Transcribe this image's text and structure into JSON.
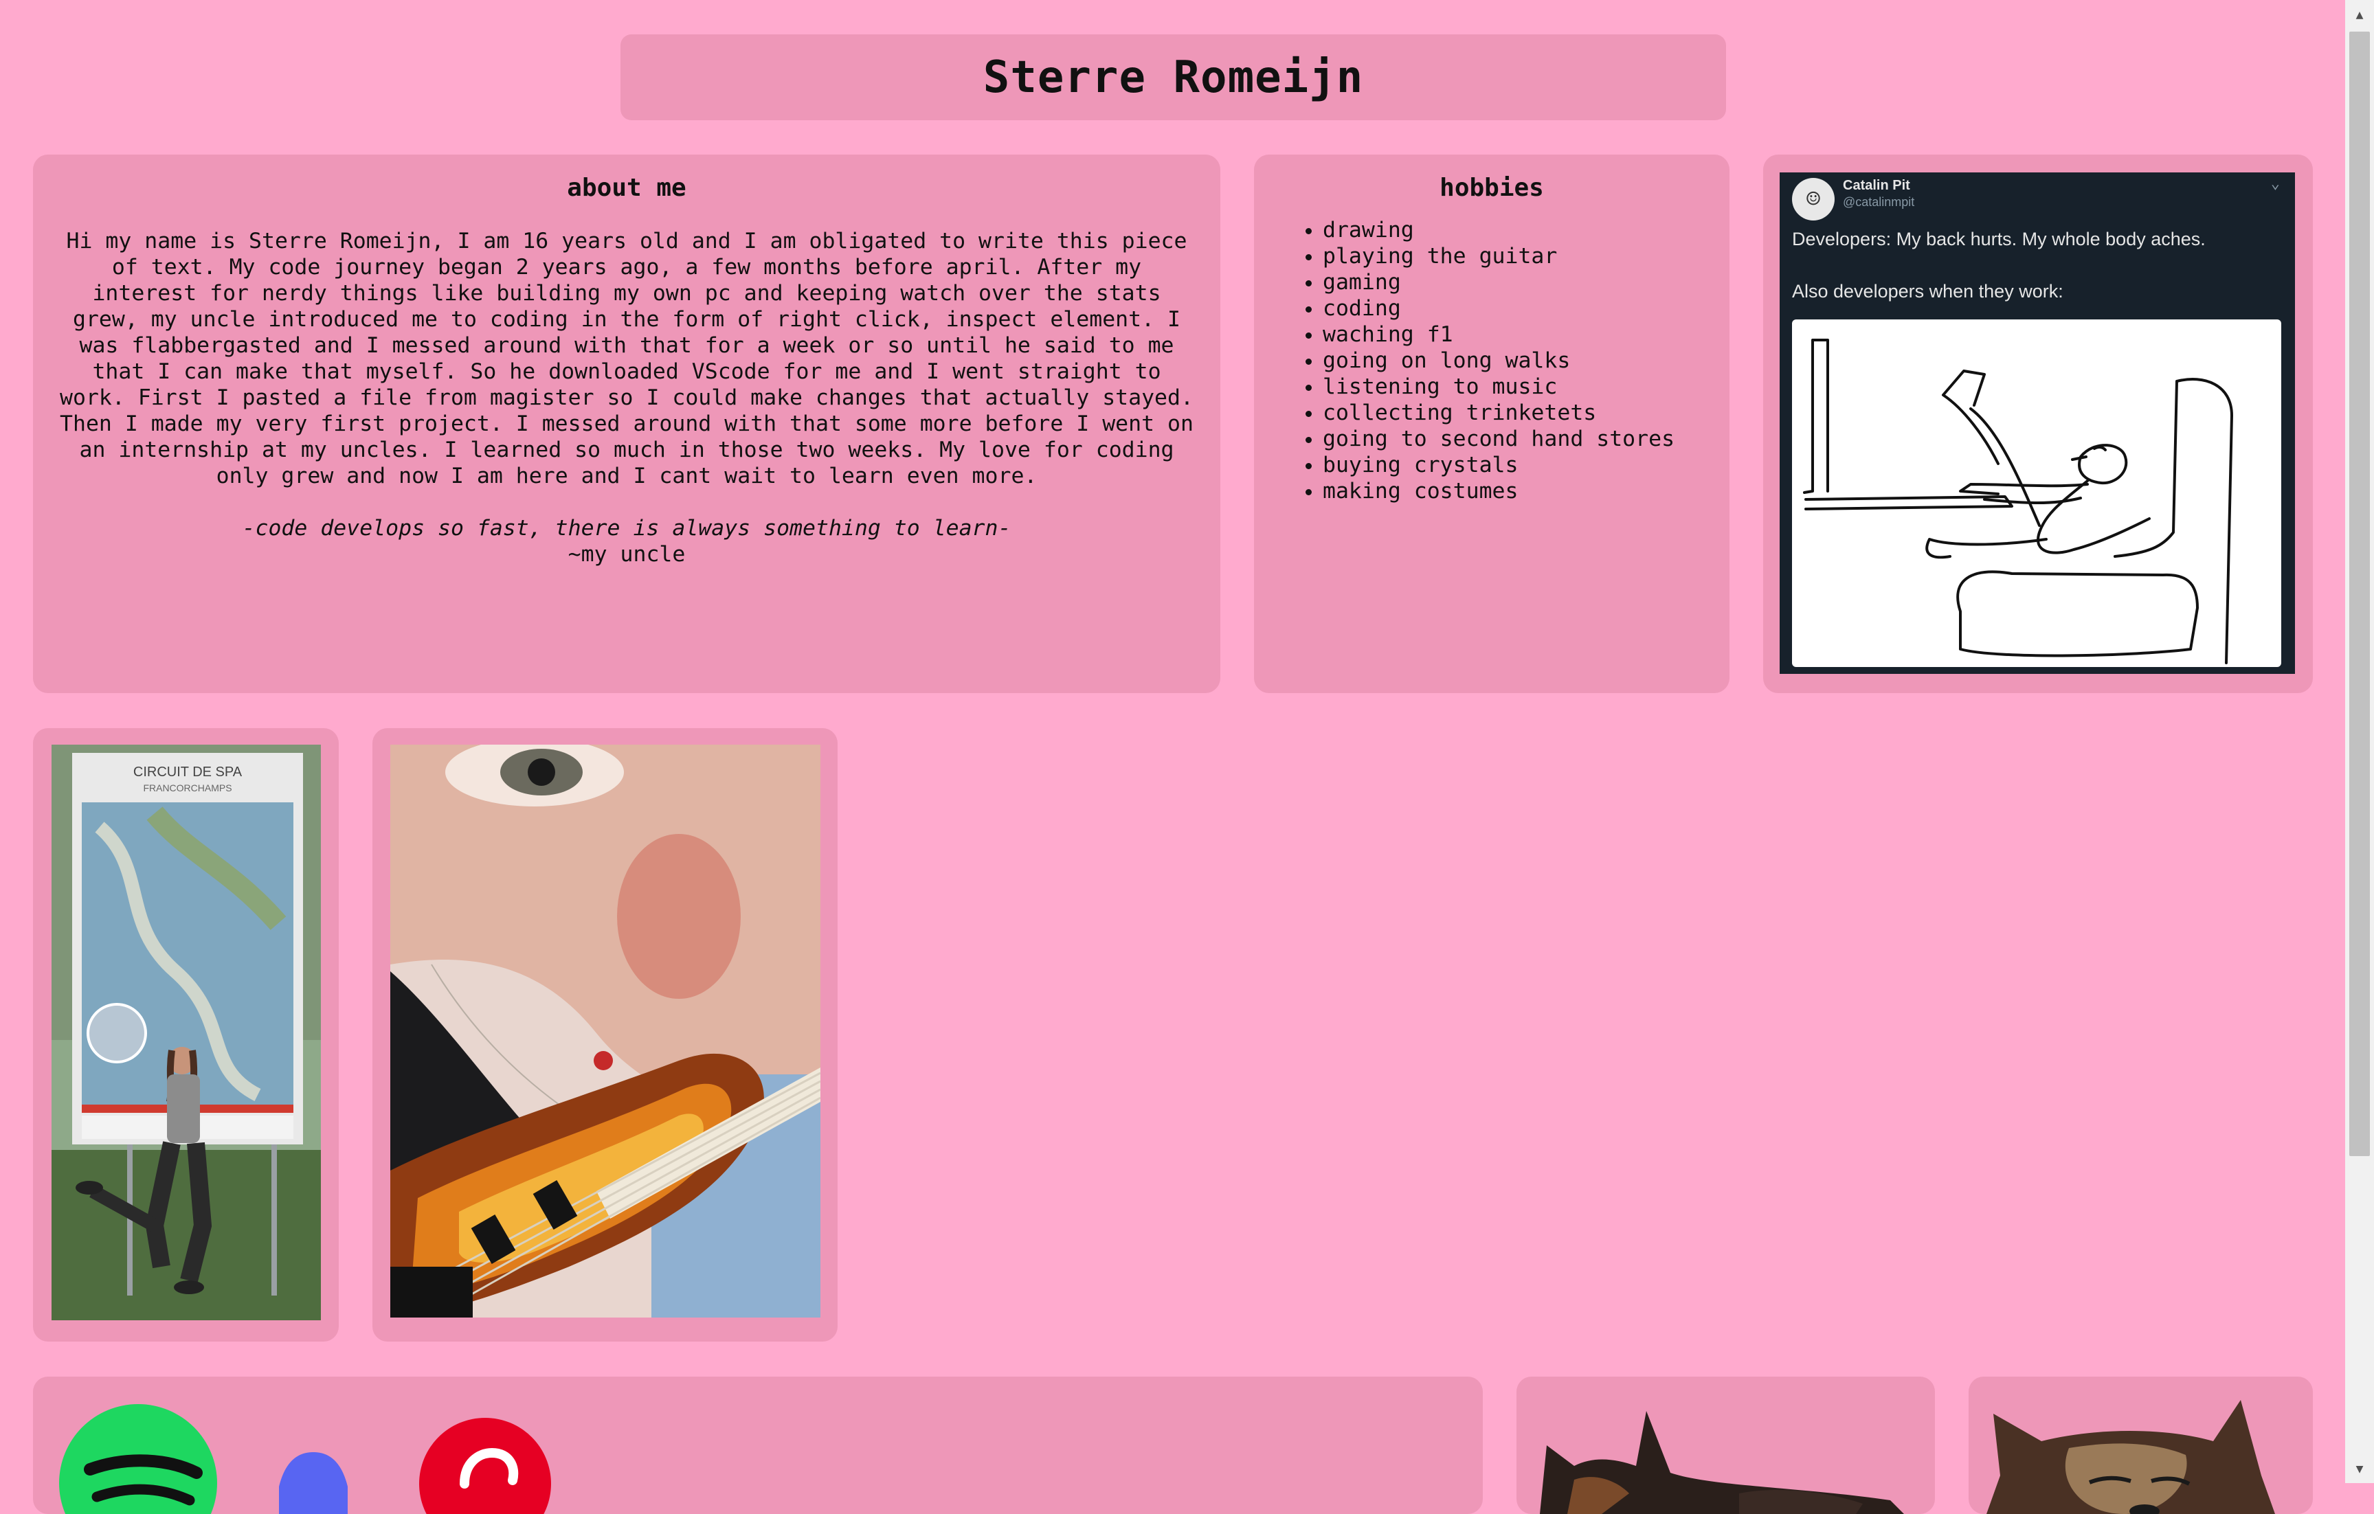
{
  "header": {
    "title": "Sterre Romeijn"
  },
  "about": {
    "heading": "about me",
    "text": "Hi my name is Sterre Romeijn, I am 16 years old and I am obligated to write this piece of text. My code journey began 2 years ago, a few months before april. After my interest for nerdy things like building my own pc and keeping watch over the stats grew, my uncle introduced me to coding in the form of right click, inspect element. I was flabbergasted and I messed around with that for a week or so until he said to me that I can make that myself. So he downloaded VScode for me and I went straight to work. First I pasted a file from magister so I could make changes that actually stayed. Then I made my very first project. I messed around with that some more before I went on an internship at my uncles. I learned so much in those two weeks. My love for coding only grew and now I am here and I cant wait to learn even more.",
    "quote": "-code develops so fast, there is always something to learn-",
    "quote_author": "~my uncle"
  },
  "hobbies": {
    "heading": "hobbies",
    "items": [
      "drawing",
      "playing the guitar",
      "gaming",
      "coding",
      "waching f1",
      "going on long walks",
      "listening to music",
      "collecting trinketets",
      "going to second hand stores",
      "buying crystals",
      "making costumes"
    ]
  },
  "meme": {
    "author_name": "Catalin Pit",
    "author_handle": "@catalinmpit",
    "line1": "Developers: My back hurts. My whole body aches.",
    "line2": "Also developers when they work:"
  },
  "photos": {
    "circuit_sign_title": "CIRCUIT DE SPA",
    "circuit_sign_subtitle": "FRANCORCHAMPS"
  },
  "social": {
    "icons": [
      "spotify-icon",
      "discord-icon",
      "pinterest-icon"
    ]
  },
  "colors": {
    "page_background": "#ffaace",
    "box_background": "#ee97b8",
    "spotify": "#1ed760",
    "discord": "#5865f2",
    "pinterest": "#e60023"
  }
}
